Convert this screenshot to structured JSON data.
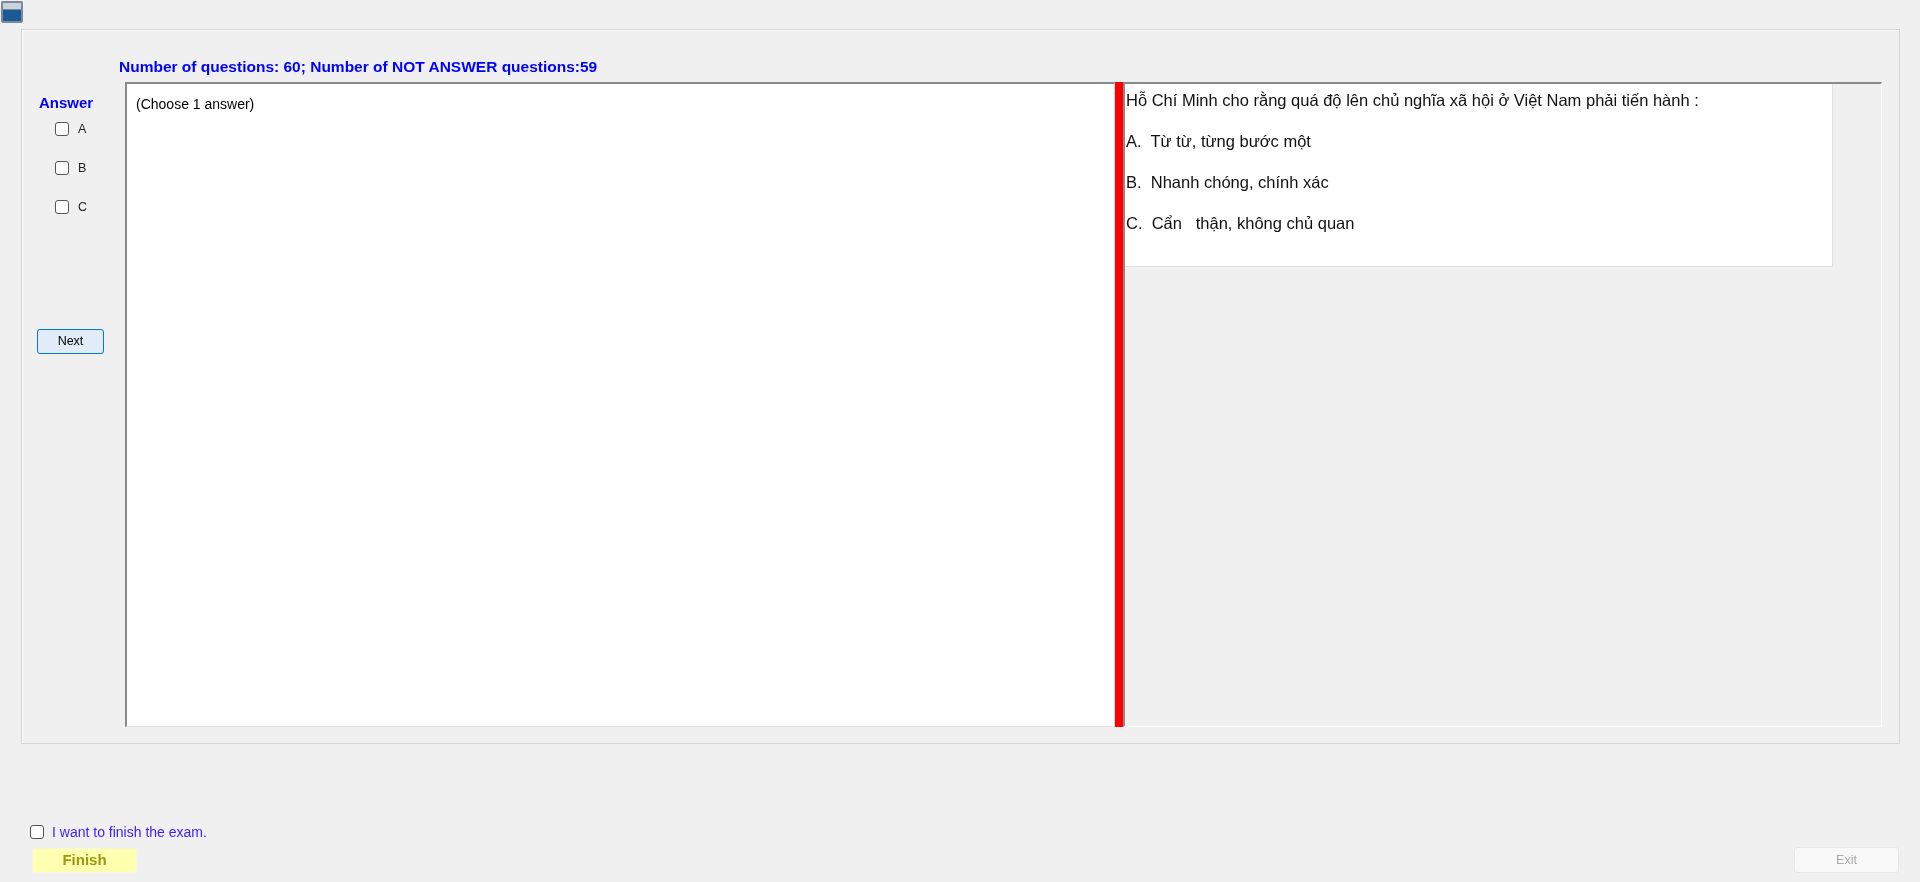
{
  "header": {
    "summary": "Number of questions: 60; Number of NOT ANSWER questions:59"
  },
  "answer_panel": {
    "title": "Answer",
    "options": [
      {
        "label": "A",
        "checked": false
      },
      {
        "label": "B",
        "checked": false
      },
      {
        "label": "C",
        "checked": false
      }
    ],
    "next_button": {
      "label": "Next"
    }
  },
  "answer_box": {
    "text": "(Choose 1 answer)"
  },
  "question": {
    "stem": "Hỗ Chí Minh cho rằng quá độ lên chủ nghĩa xã hội ở Việt Nam phải tiến hành :",
    "choices": [
      "A.  Từ từ, từng bước một",
      "B.  Nhanh chóng, chính xác",
      "C.  Cẩn   thận, không chủ quan"
    ]
  },
  "footer": {
    "confirm": {
      "label": "I want to finish the exam.",
      "checked": false
    },
    "finish_button": {
      "label": "Finish"
    },
    "exit_button": {
      "label": "Exit",
      "disabled": true
    }
  }
}
